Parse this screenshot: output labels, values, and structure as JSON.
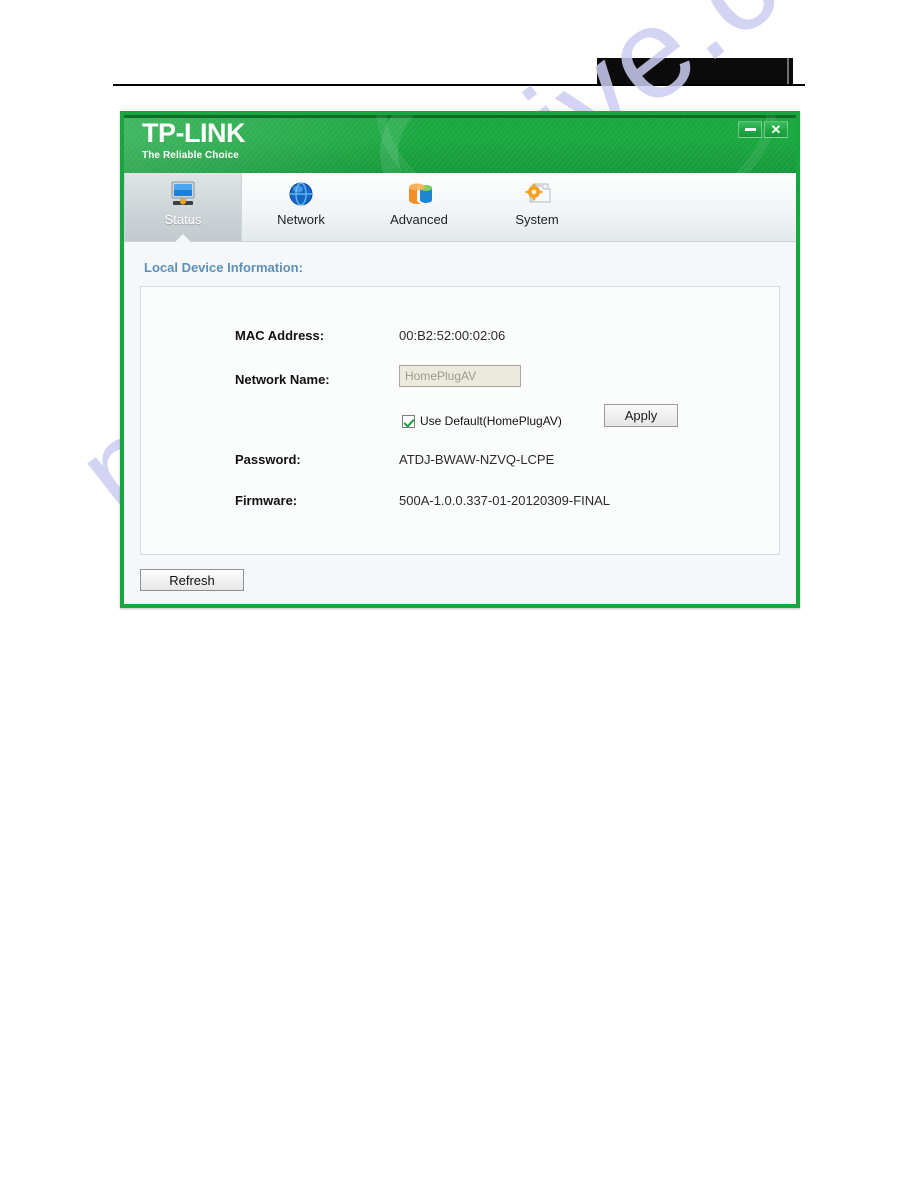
{
  "window": {
    "brand_name": "TP-LINK",
    "brand_tagline": "The Reliable Choice",
    "minimize_label": "",
    "close_label": "✕",
    "accent_green": "#17a640",
    "section_title_color": "#5f8fb5"
  },
  "tabs": [
    {
      "label": "Status",
      "icon": "monitor-icon",
      "active": true
    },
    {
      "label": "Network",
      "icon": "globe-icon",
      "active": false
    },
    {
      "label": "Advanced",
      "icon": "database-icon",
      "active": false
    },
    {
      "label": "System",
      "icon": "gear-icon",
      "active": false
    }
  ],
  "content": {
    "section_title": "Local Device Information:",
    "fields": {
      "mac_label": "MAC  Address:",
      "mac_value": "00:B2:52:00:02:06",
      "network_name_label": "Network Name:",
      "network_name_value": "HomePlugAV",
      "network_name_placeholder": "HomePlugAV",
      "use_default_label": "Use Default(HomePlugAV)",
      "use_default_checked": true,
      "password_label": "Password:",
      "password_value": "ATDJ-BWAW-NZVQ-LCPE",
      "firmware_label": "Firmware:",
      "firmware_value": "500A-1.0.0.337-01-20120309-FINAL"
    },
    "apply_label": "Apply",
    "refresh_label": "Refresh"
  },
  "page": {
    "watermark_text": "manualshive.com"
  }
}
